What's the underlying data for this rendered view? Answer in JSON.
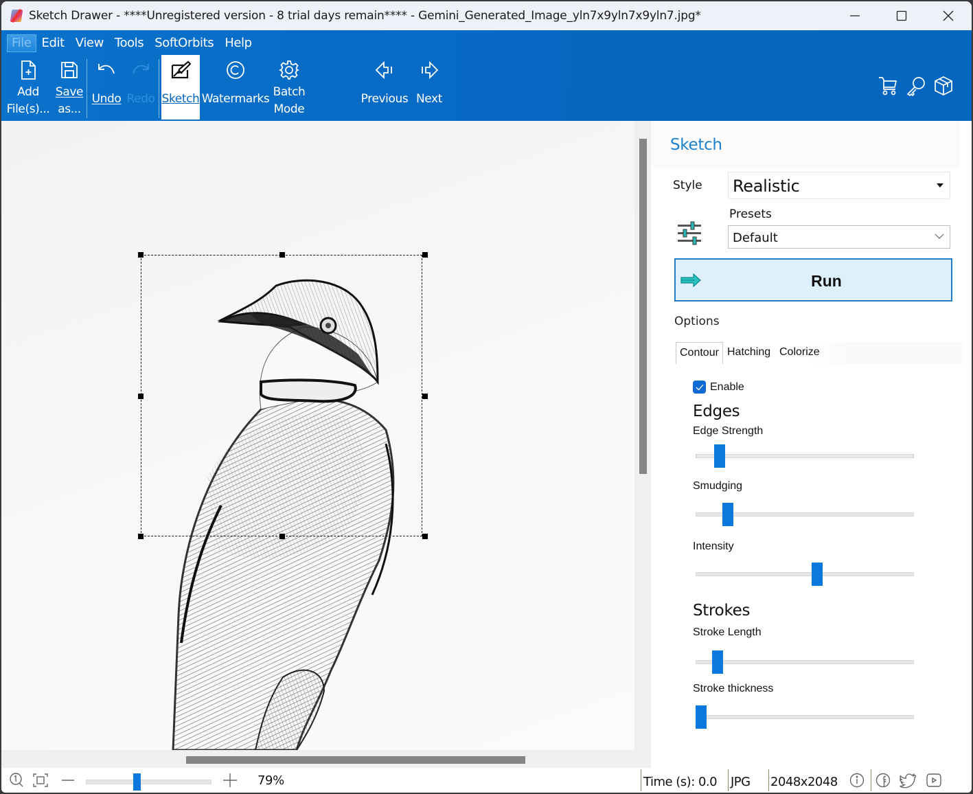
{
  "window": {
    "title": "Sketch Drawer - ****Unregistered version - 8 trial days remain**** - Gemini_Generated_Image_yln7x9yln7x9yln7.jpg*",
    "controls": [
      "minimize",
      "maximize",
      "close"
    ]
  },
  "menu": {
    "items": [
      {
        "label": "File",
        "active": true
      },
      {
        "label": "Edit"
      },
      {
        "label": "View"
      },
      {
        "label": "Tools"
      },
      {
        "label": "SoftOrbits"
      },
      {
        "label": "Help"
      }
    ]
  },
  "toolbar": {
    "add_files": {
      "line1": "Add",
      "line2": "File(s)...",
      "icon": "add-file-icon"
    },
    "save_as": {
      "line1": "Save",
      "line2": "as...",
      "icon": "save-icon"
    },
    "undo": {
      "label": "Undo",
      "icon": "undo-icon"
    },
    "redo": {
      "label": "Redo",
      "icon": "redo-icon",
      "disabled": true
    },
    "sketch": {
      "label": "Sketch",
      "icon": "sketch-icon",
      "active": true
    },
    "watermarks": {
      "label": "Watermarks",
      "icon": "copyright-icon"
    },
    "batch_mode": {
      "line1": "Batch",
      "line2": "Mode",
      "icon": "gear-icon"
    },
    "previous": {
      "label": "Previous",
      "icon": "arrow-left-icon"
    },
    "next": {
      "label": "Next",
      "icon": "arrow-right-icon"
    },
    "right_icons": [
      "cart-icon",
      "key-icon",
      "box-icon"
    ]
  },
  "panel": {
    "title": "Sketch",
    "style_label": "Style",
    "style_value": "Realistic",
    "presets_label": "Presets",
    "presets_value": "Default",
    "run_label": "Run",
    "options_label": "Options",
    "tabs": [
      {
        "label": "Contour",
        "active": true
      },
      {
        "label": "Hatching"
      },
      {
        "label": "Colorize"
      }
    ],
    "enable_label": "Enable",
    "enable_checked": true,
    "edges_title": "Edges",
    "strokes_title": "Strokes",
    "sliders": {
      "edge_strength": {
        "label": "Edge Strength",
        "value": 0.09
      },
      "smudging": {
        "label": "Smudging",
        "value": 0.13
      },
      "intensity": {
        "label": "Intensity",
        "value": 0.56
      },
      "stroke_length": {
        "label": "Stroke Length",
        "value": 0.08
      },
      "stroke_thickness": {
        "label": "Stroke thickness",
        "value": 0.0
      }
    }
  },
  "canvas": {
    "vscroll": {
      "position": 0.0,
      "visible_fraction": 0.55
    },
    "hscroll": {
      "position": 0.45,
      "visible_fraction": 0.55
    }
  },
  "status": {
    "zoom_percent": "79%",
    "zoom_slider_value": 0.4,
    "time": "Time (s): 0.0",
    "format": "JPG",
    "dimensions": "2048x2048",
    "icons": [
      "info-icon",
      "facebook-icon",
      "twitter-icon",
      "youtube-icon"
    ]
  }
}
